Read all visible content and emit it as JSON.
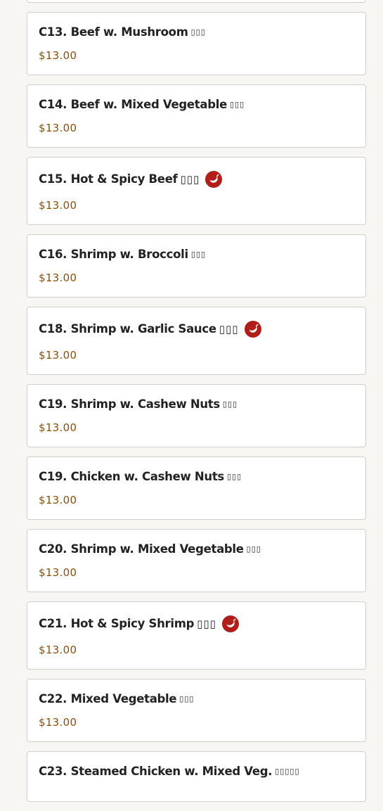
{
  "menu": {
    "items": [
      {
        "name": "C13. Beef w. Mushroom",
        "cjk": "▯▯▯",
        "price": "$13.00",
        "spicy": false
      },
      {
        "name": "C14. Beef w. Mixed Vegetable",
        "cjk": "▯▯▯",
        "price": "$13.00",
        "spicy": false
      },
      {
        "name": "C15. Hot & Spicy Beef",
        "cjk": "▯▯▯",
        "price": "$13.00",
        "spicy": true
      },
      {
        "name": "C16. Shrimp w. Broccoli",
        "cjk": "▯▯▯",
        "price": "$13.00",
        "spicy": false
      },
      {
        "name": "C18. Shrimp w. Garlic Sauce",
        "cjk": "▯▯▯",
        "price": "$13.00",
        "spicy": true
      },
      {
        "name": "C19. Shrimp w. Cashew Nuts",
        "cjk": "▯▯▯",
        "price": "$13.00",
        "spicy": false
      },
      {
        "name": "C19. Chicken w. Cashew Nuts",
        "cjk": "▯▯▯",
        "price": "$13.00",
        "spicy": false
      },
      {
        "name": "C20. Shrimp w. Mixed Vegetable",
        "cjk": "▯▯▯",
        "price": "$13.00",
        "spicy": false
      },
      {
        "name": "C21. Hot & Spicy Shrimp",
        "cjk": "▯▯▯",
        "price": "$13.00",
        "spicy": true
      },
      {
        "name": "C22. Mixed Vegetable",
        "cjk": "▯▯▯",
        "price": "$13.00",
        "spicy": false
      },
      {
        "name": "C23. Steamed Chicken w. Mixed Veg.",
        "cjk": "▯▯▯▯▯",
        "price": "",
        "spicy": false
      }
    ],
    "spicy_icon": "chili-pepper-icon",
    "colors": {
      "price": "#8c4f06",
      "spicy_badge": "#b11e1a",
      "background": "#f8f6f2"
    }
  }
}
